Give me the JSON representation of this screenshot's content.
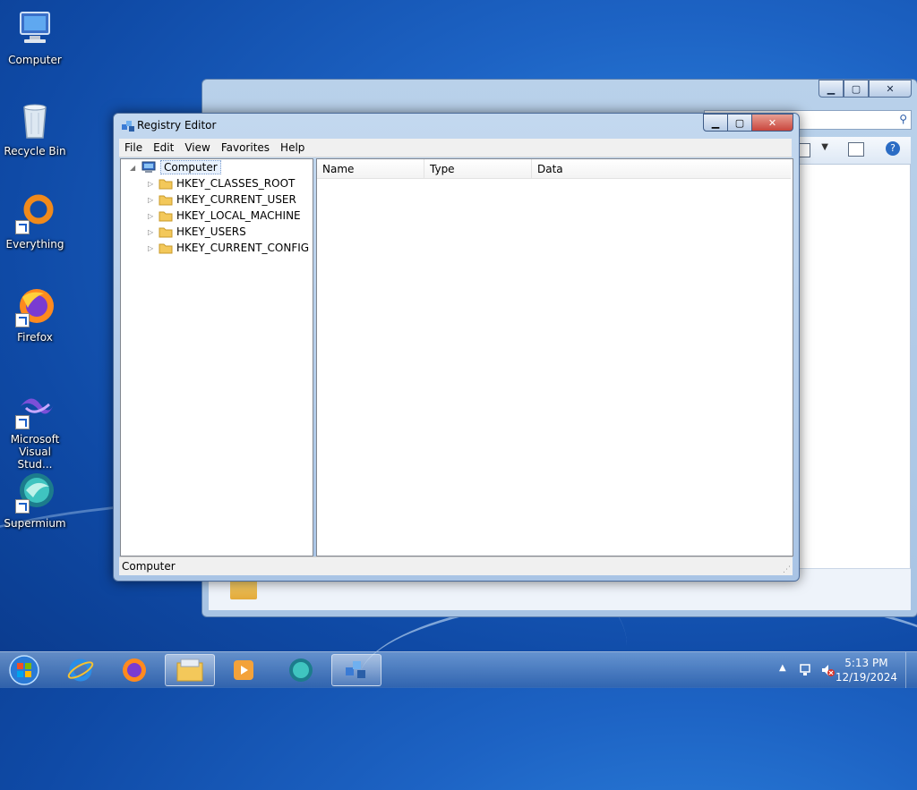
{
  "desktop": {
    "icons": [
      {
        "label": "Computer",
        "icon": "computer-icon"
      },
      {
        "label": "Recycle Bin",
        "icon": "recycle-bin-icon"
      },
      {
        "label": "Everything",
        "icon": "everything-icon"
      },
      {
        "label": "Firefox",
        "icon": "firefox-icon"
      },
      {
        "label_line1": "Microsoft",
        "label_line2": "Visual Stud...",
        "icon": "visual-studio-icon"
      },
      {
        "label": "Supermium",
        "icon": "supermium-icon"
      }
    ]
  },
  "regedit": {
    "title": "Registry Editor",
    "menu": [
      "File",
      "Edit",
      "View",
      "Favorites",
      "Help"
    ],
    "tree": {
      "root": "Computer",
      "children": [
        "HKEY_CLASSES_ROOT",
        "HKEY_CURRENT_USER",
        "HKEY_LOCAL_MACHINE",
        "HKEY_USERS",
        "HKEY_CURRENT_CONFIG"
      ]
    },
    "columns": [
      "Name",
      "Type",
      "Data"
    ],
    "status": "Computer"
  },
  "taskbar": {
    "time": "5:13 PM",
    "date": "12/19/2024",
    "items": [
      "start-orb",
      "internet-explorer-icon",
      "firefox-icon",
      "file-explorer-icon",
      "media-player-icon",
      "supermium-icon",
      "registry-editor-icon"
    ]
  },
  "colors": {
    "desktop_blue": "#1d63c4",
    "close_red": "#c9463d"
  }
}
